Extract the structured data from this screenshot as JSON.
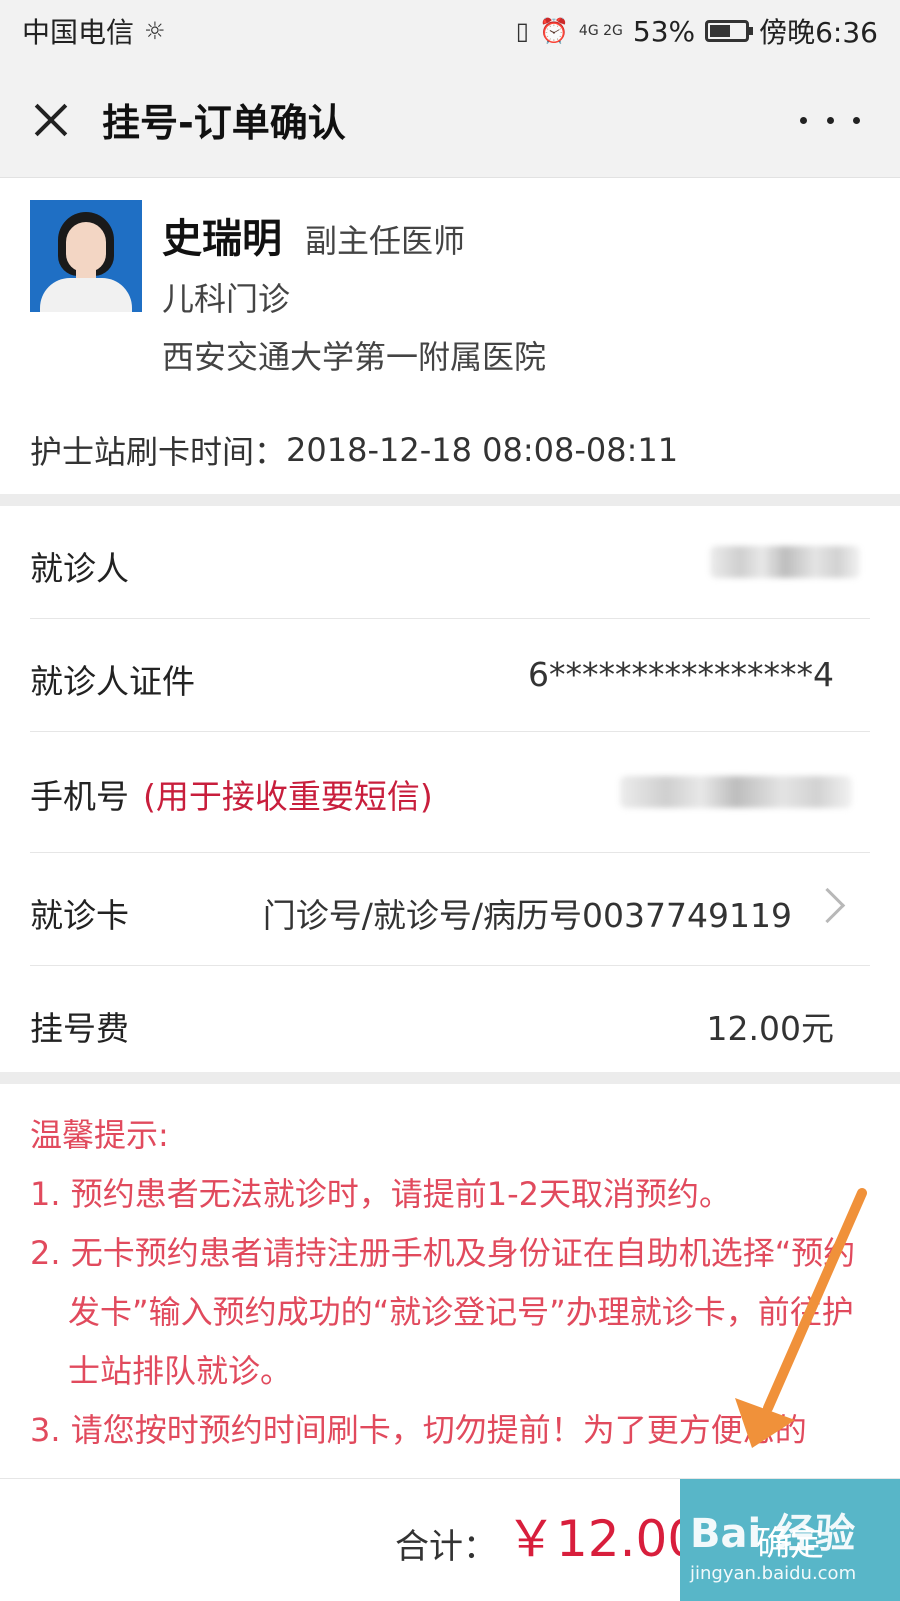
{
  "status_bar": {
    "carrier": "中国电信",
    "network": "4G 2G",
    "battery_percent": "53%",
    "time": "傍晚6:36"
  },
  "nav": {
    "title": "挂号-订单确认",
    "close_icon": "close-icon",
    "more_icon": "more-icon"
  },
  "doctor": {
    "name": "史瑞明",
    "title": "副主任医师",
    "department": "儿科门诊",
    "hospital": "西安交通大学第一附属医院"
  },
  "appointment": {
    "label": "护士站刷卡时间：",
    "value": "2018-12-18 08:08-08:11"
  },
  "form": {
    "patient_label": "就诊人",
    "id_label": "就诊人证件",
    "id_value": "6****************4",
    "phone_label": "手机号",
    "phone_hint": "(用于接收重要短信)",
    "card_label": "就诊卡",
    "card_value": "门诊号/就诊号/病历号0037749119",
    "fee_label": "挂号费",
    "fee_value": "12.00元"
  },
  "tips": {
    "title": "温馨提示:",
    "items": [
      "1. 预约患者无法就诊时，请提前1-2天取消预约。",
      "2. 无卡预约患者请持注册手机及身份证在自助机选择“预约发卡”输入预约成功的“就诊登记号”办理就诊卡，前往护士站排队就诊。",
      "3. 请您按时预约时间刷卡，切勿提前！为了更方便您的"
    ]
  },
  "footer": {
    "total_label": "合计：",
    "total_amount": "￥12.00",
    "confirm_label": "确定"
  },
  "watermark": {
    "main": "Bai 经验",
    "sub": "jingyan.baidu.com"
  },
  "colors": {
    "accent_red": "#d81e3c",
    "tip_red": "#e14a5d",
    "button": "#58b6c8",
    "annotation_arrow": "#f0913a"
  }
}
